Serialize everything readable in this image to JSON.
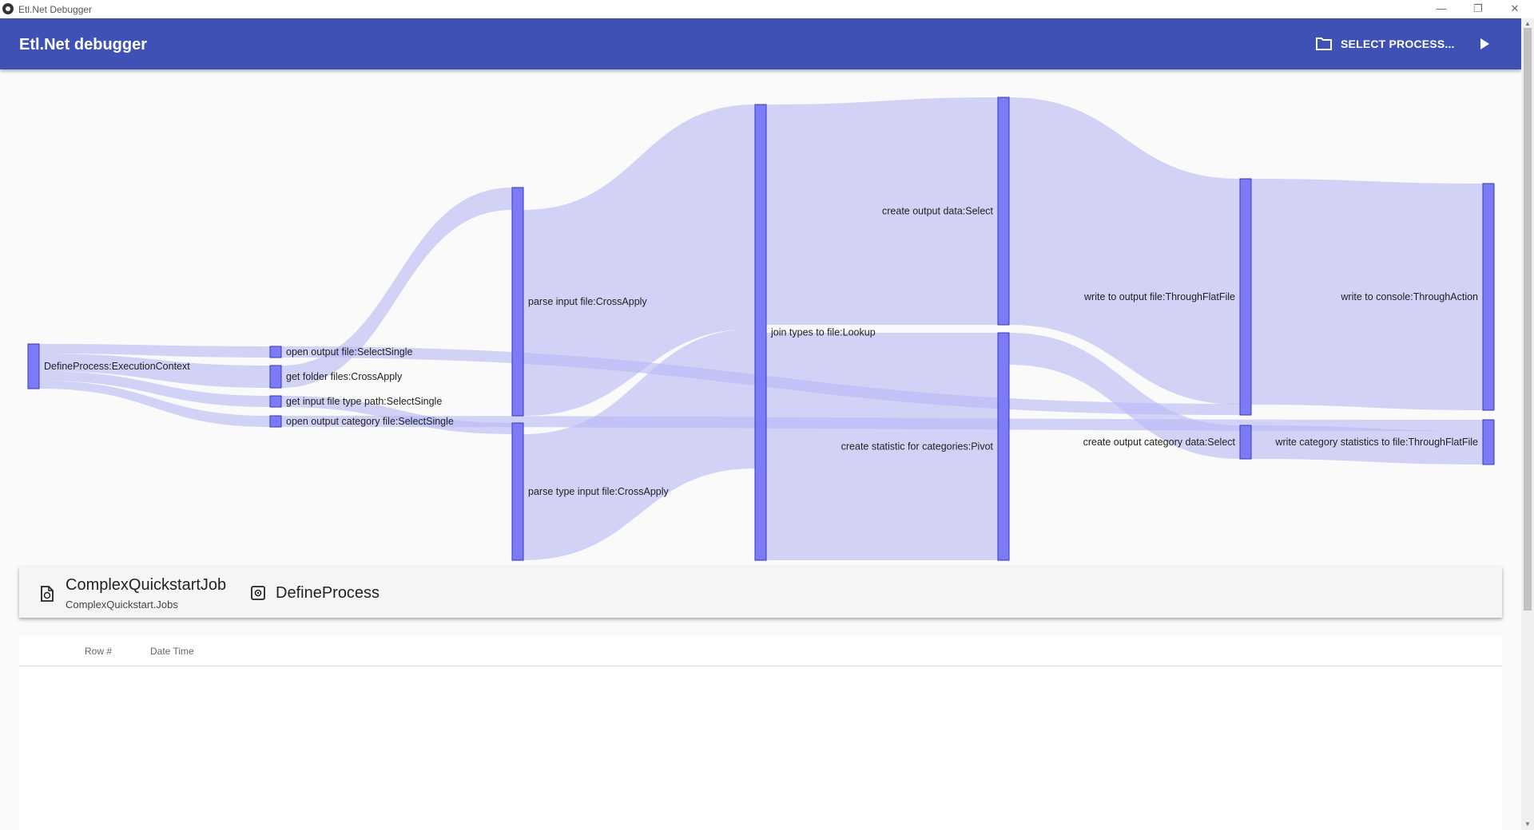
{
  "window": {
    "title": "Etl.Net Debugger",
    "controls": {
      "minimize": "—",
      "restore": "❐",
      "close": "✕"
    }
  },
  "appbar": {
    "title": "Etl.Net debugger",
    "select_process_label": "SELECT PROCESS...",
    "icons": {
      "select": "folder-icon",
      "run": "play-icon"
    }
  },
  "sankey": {
    "nodes": [
      {
        "id": "n0",
        "label": "DefineProcess:ExecutionContext"
      },
      {
        "id": "n1",
        "label": "open output file:SelectSingle"
      },
      {
        "id": "n2",
        "label": "get folder files:CrossApply"
      },
      {
        "id": "n3",
        "label": "get input file type path:SelectSingle"
      },
      {
        "id": "n4",
        "label": "open output category file:SelectSingle"
      },
      {
        "id": "n5",
        "label": "parse input file:CrossApply"
      },
      {
        "id": "n6",
        "label": "parse type input file:CrossApply"
      },
      {
        "id": "n7",
        "label": "join types to file:Lookup"
      },
      {
        "id": "n8",
        "label": "create output data:Select"
      },
      {
        "id": "n9",
        "label": "create statistic for categories:Pivot"
      },
      {
        "id": "n10",
        "label": "write to output file:ThroughFlatFile"
      },
      {
        "id": "n11",
        "label": "create output category data:Select"
      },
      {
        "id": "n12",
        "label": "write to console:ThroughAction"
      },
      {
        "id": "n13",
        "label": "write category statistics to file:ThroughFlatFile"
      }
    ],
    "links": [
      {
        "source": "n0",
        "target": "n1"
      },
      {
        "source": "n0",
        "target": "n2"
      },
      {
        "source": "n0",
        "target": "n3"
      },
      {
        "source": "n0",
        "target": "n4"
      },
      {
        "source": "n2",
        "target": "n5"
      },
      {
        "source": "n3",
        "target": "n6"
      },
      {
        "source": "n5",
        "target": "n7"
      },
      {
        "source": "n6",
        "target": "n7"
      },
      {
        "source": "n7",
        "target": "n8"
      },
      {
        "source": "n7",
        "target": "n9"
      },
      {
        "source": "n8",
        "target": "n10"
      },
      {
        "source": "n9",
        "target": "n11"
      },
      {
        "source": "n1",
        "target": "n10"
      },
      {
        "source": "n4",
        "target": "n13"
      },
      {
        "source": "n10",
        "target": "n12"
      },
      {
        "source": "n11",
        "target": "n13"
      }
    ],
    "colors": {
      "node_fill": "#7b7bf7",
      "node_stroke": "#3a3ab8",
      "link": "#b8b8f5"
    }
  },
  "info": {
    "job_icon": "file-sync-icon",
    "job_name": "ComplexQuickstartJob",
    "job_namespace": "ComplexQuickstart.Jobs",
    "process_icon": "settings-box-icon",
    "process_name": "DefineProcess"
  },
  "table": {
    "columns": [
      "Row #",
      "Date Time"
    ],
    "rows": []
  }
}
